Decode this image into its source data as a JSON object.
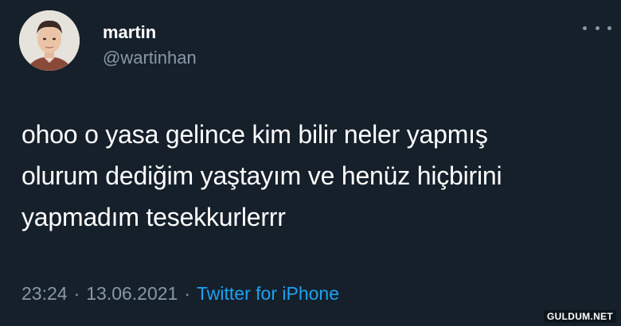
{
  "user": {
    "display_name": "martin",
    "handle": "@wartinhan",
    "avatar_icon": "profile-photo"
  },
  "tweet": {
    "text": "ohoo o yasa gelince kim bilir neler yapmış\nolurum dediğim yaştayım ve henüz hiçbirini\nyapmadım tesekkurlerrr",
    "time": "23:24",
    "separator": "·",
    "date": "13.06.2021",
    "source": "Twitter for iPhone"
  },
  "more_icon": "more-dots-icon",
  "watermark": "GULDUM.NET",
  "colors": {
    "background": "#15202b",
    "secondary_text": "#8899a6",
    "link": "#1da1f2"
  }
}
